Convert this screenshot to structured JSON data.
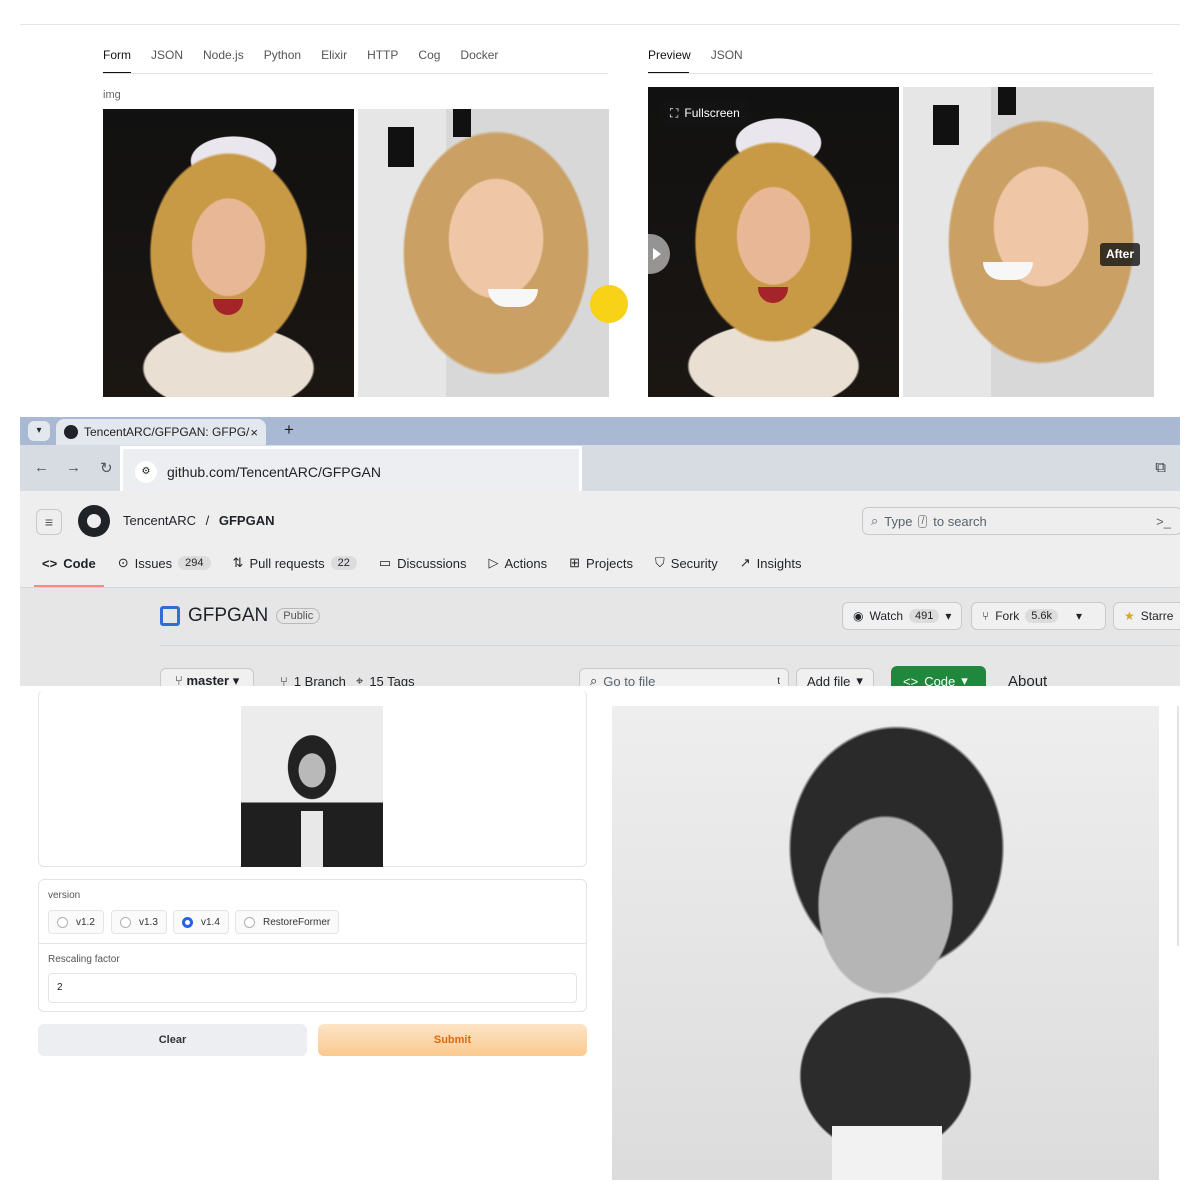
{
  "replicate": {
    "input_tabs": [
      "Form",
      "JSON",
      "Node.js",
      "Python",
      "Elixir",
      "HTTP",
      "Cog",
      "Docker"
    ],
    "output_tabs": [
      "Preview",
      "JSON"
    ],
    "img_label": "img",
    "fullscreen_label": "Fullscreen",
    "after_label": "After"
  },
  "browser": {
    "tab_title": "TencentARC/GFPGAN: GFPG/",
    "tab_close": "×",
    "new_tab": "+",
    "url": "github.com/TencentARC/GFPGAN"
  },
  "github": {
    "owner": "TencentARC",
    "separator": "/",
    "repo": "GFPGAN",
    "search_prefix": "Type",
    "search_key": "/",
    "search_suffix": "to search",
    "nav": [
      {
        "label": "Code",
        "count": ""
      },
      {
        "label": "Issues",
        "count": "294"
      },
      {
        "label": "Pull requests",
        "count": "22"
      },
      {
        "label": "Discussions",
        "count": ""
      },
      {
        "label": "Actions",
        "count": ""
      },
      {
        "label": "Projects",
        "count": ""
      },
      {
        "label": "Security",
        "count": ""
      },
      {
        "label": "Insights",
        "count": ""
      }
    ],
    "repo_title": "GFPGAN",
    "visibility": "Public",
    "watch_label": "Watch",
    "watch_count": "491",
    "fork_label": "Fork",
    "fork_count": "5.6k",
    "star_label": "Starre",
    "branch_label": "master",
    "branches": "1 Branch",
    "tags": "15 Tags",
    "goto_file": "Go to file",
    "goto_key": "t",
    "add_file": "Add file",
    "code_btn": "Code",
    "about": "About"
  },
  "gradio": {
    "version_label": "version",
    "versions": [
      "v1.2",
      "v1.3",
      "v1.4",
      "RestoreFormer"
    ],
    "selected_version": "v1.4",
    "rescale_label": "Rescaling factor",
    "rescale_value": "2",
    "clear_label": "Clear",
    "submit_label": "Submit"
  }
}
